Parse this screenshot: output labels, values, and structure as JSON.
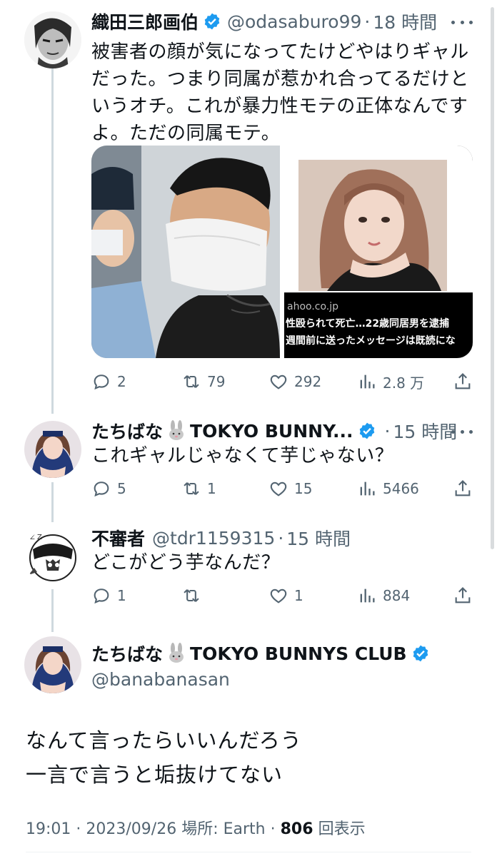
{
  "tweets": [
    {
      "name": "織田三郎画伯",
      "verified": true,
      "handle": "@odasaburo99",
      "time": "18 時間",
      "text": "被害者の顔が気になってたけどやはりギャルだった。つまり同属が惹かれ合ってるだけというオチ。これが暴力性モテの正体なんですよ。ただの同属モテ。",
      "media": {
        "source": "ahoo.co.jp",
        "headline1": "性殴られて死亡…22歳同居男を逮捕",
        "headline2": "週間前に送ったメッセージは既読にな"
      },
      "replies": "2",
      "retweets": "79",
      "likes": "292",
      "views": "2.8 万"
    },
    {
      "name": "たちばな",
      "name_suffix": "TOKYO BUNNY...",
      "verified": true,
      "time": "15 時間",
      "text": "これギャルじゃなくて芋じゃない？",
      "replies": "5",
      "retweets": "1",
      "likes": "15",
      "views": "5466"
    },
    {
      "name": "不審者",
      "verified": false,
      "handle": "@tdr1159315",
      "time": "15 時間",
      "text": "どこがどう芋なんだ？",
      "replies": "1",
      "retweets": "",
      "likes": "1",
      "views": "884"
    }
  ],
  "main_tweet": {
    "name": "たちばな",
    "name_suffix": "TOKYO BUNNYS CLUB",
    "handle": "@banabanasan",
    "line1": "なんて言ったらいいんだろう",
    "line2": "一言で言うと垢抜けてない",
    "time": "19:01",
    "date": "2023/09/26",
    "location": "場所: Earth",
    "views_count": "806",
    "views_label": "回表示"
  },
  "colors": {
    "text": "#0f1419",
    "secondary": "#536471",
    "verified": "#1d9bf0",
    "thread_line": "#cfd9de"
  }
}
